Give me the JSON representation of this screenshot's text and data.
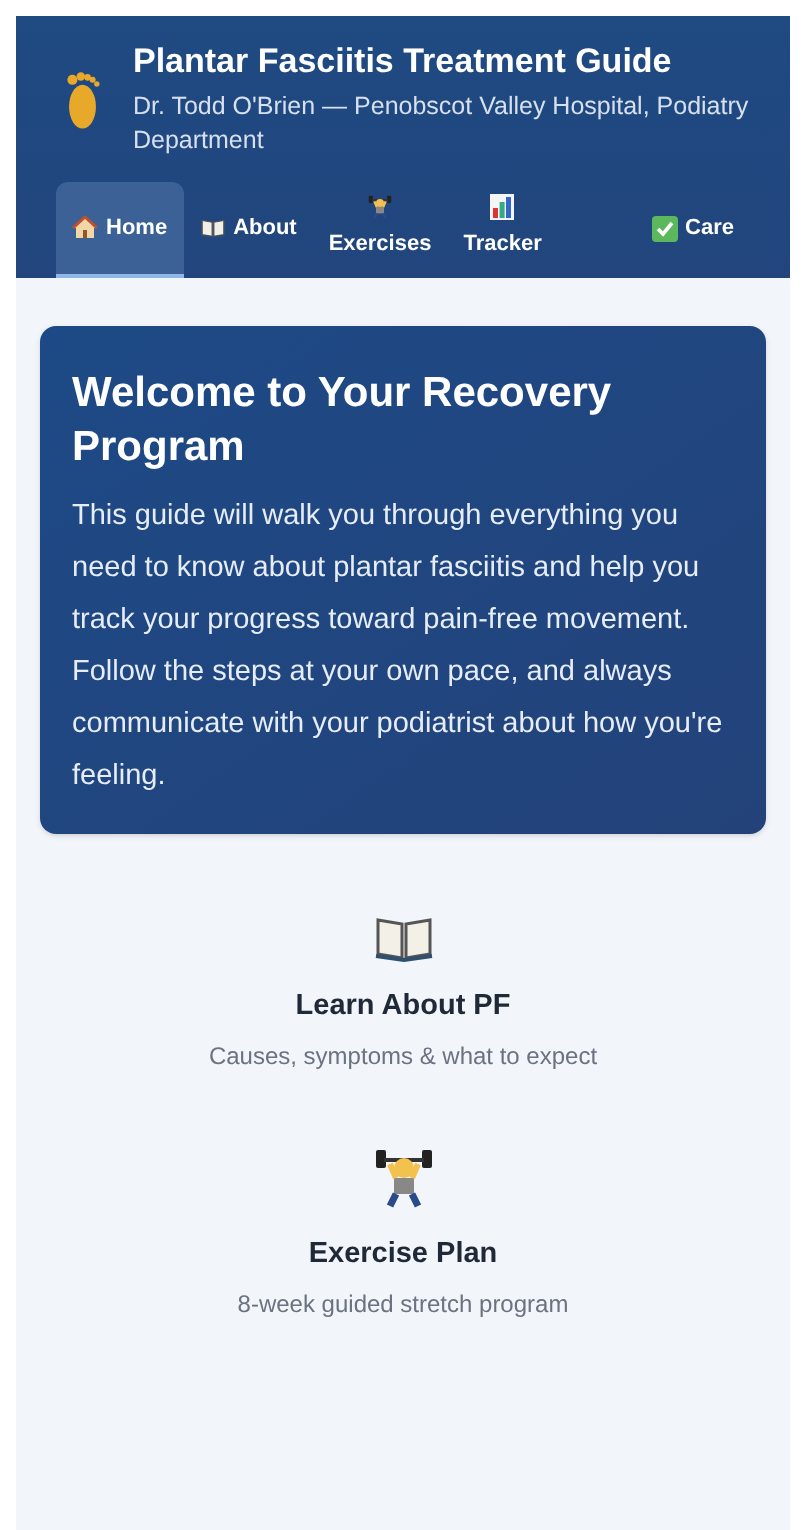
{
  "header": {
    "title": "Plantar Fasciitis Treatment Guide",
    "subtitle": "Dr. Todd O'Brien — Penobscot Valley Hospital, Podiatry Department"
  },
  "tabs": [
    {
      "label": "Home",
      "selected": true
    },
    {
      "label": "About",
      "selected": false
    },
    {
      "label": "Exercises",
      "selected": false
    },
    {
      "label": "Tracker",
      "selected": false
    },
    {
      "label": "Care",
      "selected": false
    }
  ],
  "welcome": {
    "title": "Welcome to Your Recovery Program",
    "body": "This guide will walk you through everything you need to know about plantar fasciitis and help you track your progress toward pain-free movement. Follow the steps at your own pace, and always communicate with your podiatrist about how you're feeling."
  },
  "links": [
    {
      "title": "Learn About PF",
      "description": "Causes, symptoms & what to expect"
    },
    {
      "title": "Exercise Plan",
      "description": "8-week guided stretch program"
    }
  ]
}
